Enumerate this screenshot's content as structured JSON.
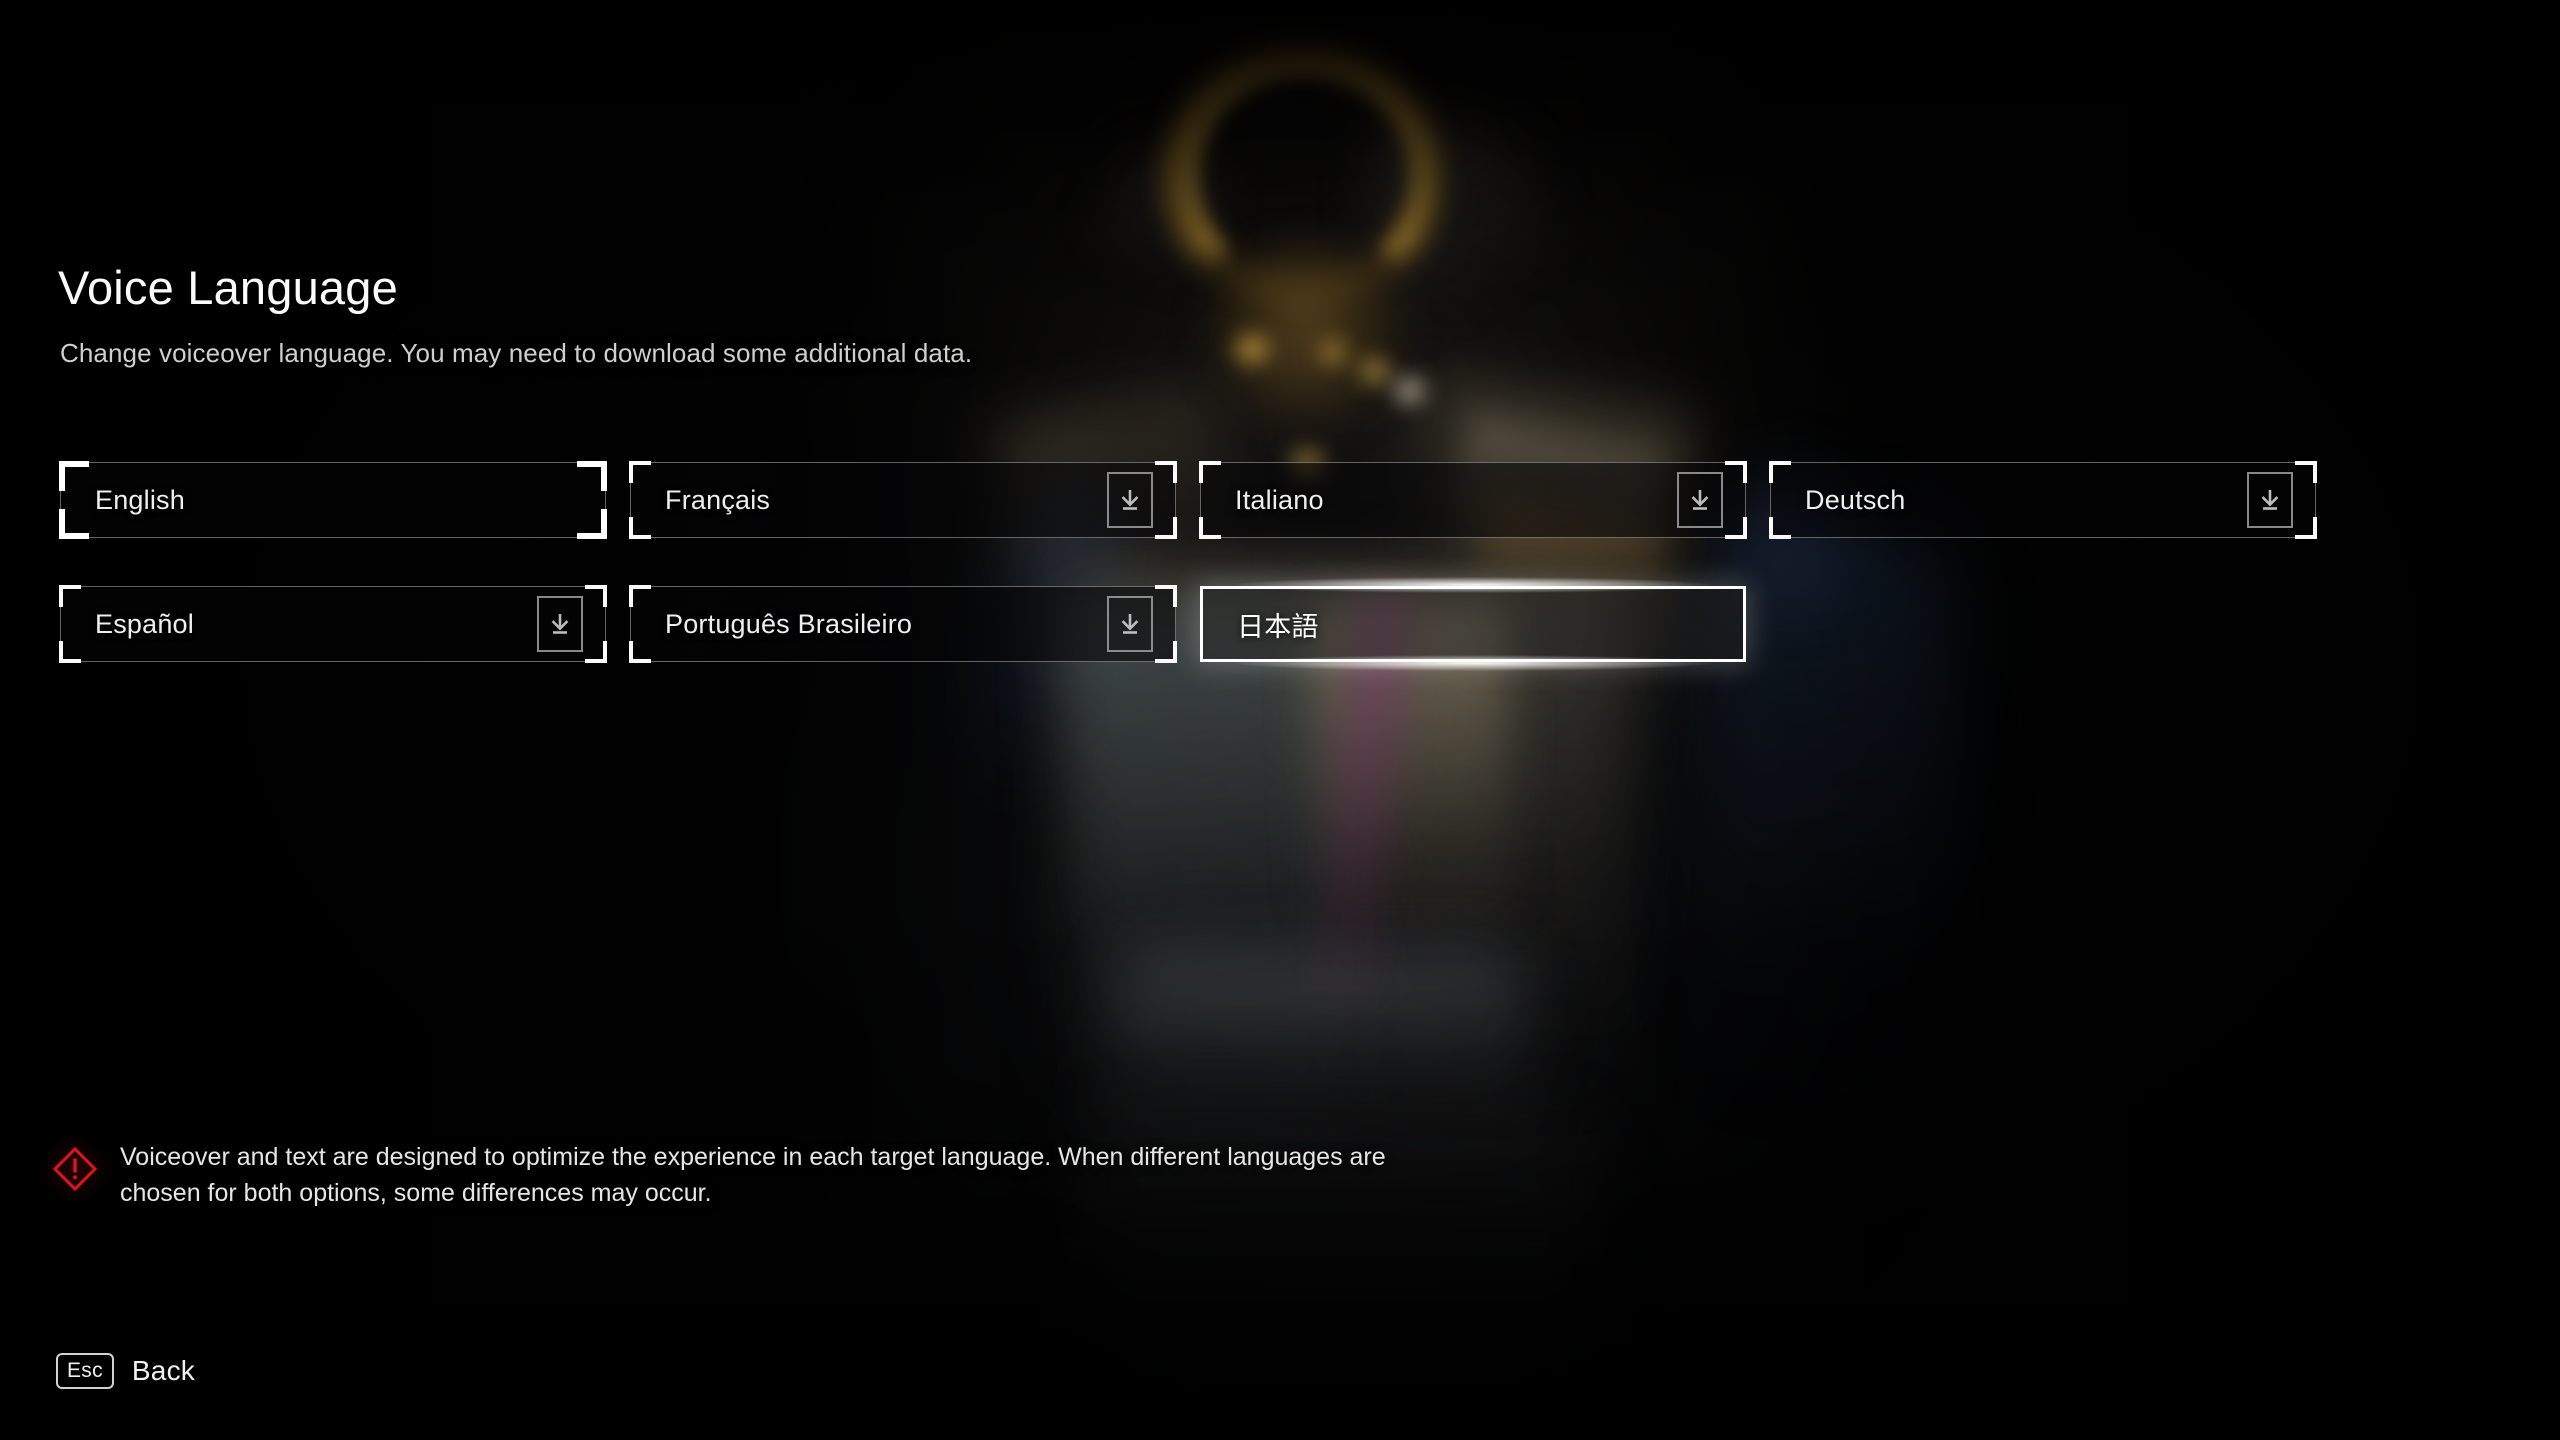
{
  "screen": {
    "title": "Voice Language",
    "subtitle": "Change voiceover language. You may need to download some additional data."
  },
  "languages": [
    {
      "label": "English",
      "download": false,
      "state": "selected"
    },
    {
      "label": "Français",
      "download": true,
      "state": "normal"
    },
    {
      "label": "Italiano",
      "download": true,
      "state": "normal"
    },
    {
      "label": "Deutsch",
      "download": true,
      "state": "normal"
    },
    {
      "label": "Español",
      "download": true,
      "state": "normal"
    },
    {
      "label": "Português Brasileiro",
      "download": true,
      "state": "normal"
    },
    {
      "label": "日本語",
      "download": false,
      "state": "focused"
    }
  ],
  "warning": {
    "icon": "warning-diamond-icon",
    "text": "Voiceover and text are designed to optimize the experience in each target language. When different languages are chosen for both options, some differences may occur."
  },
  "footer": {
    "key": "Esc",
    "action": "Back"
  },
  "icons": {
    "download": "download-icon"
  },
  "colors": {
    "background": "#000000",
    "text_primary": "#f2f2f2",
    "text_secondary": "#cfcfcf",
    "border": "#b0b0b0",
    "focus": "#ffffff",
    "warning": "#e2121e"
  }
}
